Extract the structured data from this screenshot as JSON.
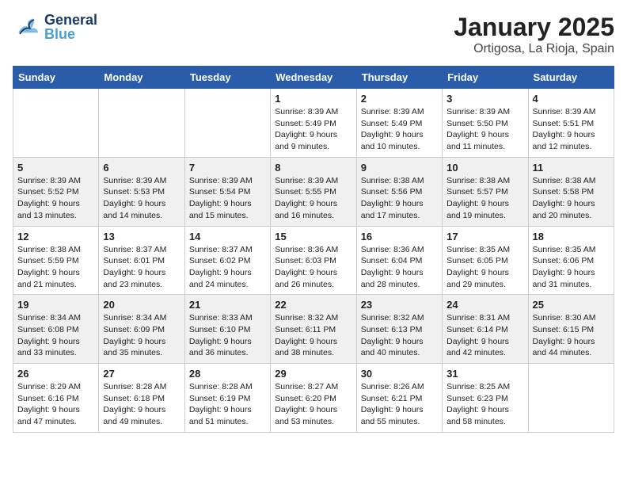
{
  "header": {
    "logo": {
      "line1": "General",
      "line2": "Blue"
    },
    "month": "January 2025",
    "location": "Ortigosa, La Rioja, Spain"
  },
  "weekdays": [
    "Sunday",
    "Monday",
    "Tuesday",
    "Wednesday",
    "Thursday",
    "Friday",
    "Saturday"
  ],
  "weeks": [
    [
      {
        "day": "",
        "info": ""
      },
      {
        "day": "",
        "info": ""
      },
      {
        "day": "",
        "info": ""
      },
      {
        "day": "1",
        "info": "Sunrise: 8:39 AM\nSunset: 5:49 PM\nDaylight: 9 hours\nand 9 minutes."
      },
      {
        "day": "2",
        "info": "Sunrise: 8:39 AM\nSunset: 5:49 PM\nDaylight: 9 hours\nand 10 minutes."
      },
      {
        "day": "3",
        "info": "Sunrise: 8:39 AM\nSunset: 5:50 PM\nDaylight: 9 hours\nand 11 minutes."
      },
      {
        "day": "4",
        "info": "Sunrise: 8:39 AM\nSunset: 5:51 PM\nDaylight: 9 hours\nand 12 minutes."
      }
    ],
    [
      {
        "day": "5",
        "info": "Sunrise: 8:39 AM\nSunset: 5:52 PM\nDaylight: 9 hours\nand 13 minutes."
      },
      {
        "day": "6",
        "info": "Sunrise: 8:39 AM\nSunset: 5:53 PM\nDaylight: 9 hours\nand 14 minutes."
      },
      {
        "day": "7",
        "info": "Sunrise: 8:39 AM\nSunset: 5:54 PM\nDaylight: 9 hours\nand 15 minutes."
      },
      {
        "day": "8",
        "info": "Sunrise: 8:39 AM\nSunset: 5:55 PM\nDaylight: 9 hours\nand 16 minutes."
      },
      {
        "day": "9",
        "info": "Sunrise: 8:38 AM\nSunset: 5:56 PM\nDaylight: 9 hours\nand 17 minutes."
      },
      {
        "day": "10",
        "info": "Sunrise: 8:38 AM\nSunset: 5:57 PM\nDaylight: 9 hours\nand 19 minutes."
      },
      {
        "day": "11",
        "info": "Sunrise: 8:38 AM\nSunset: 5:58 PM\nDaylight: 9 hours\nand 20 minutes."
      }
    ],
    [
      {
        "day": "12",
        "info": "Sunrise: 8:38 AM\nSunset: 5:59 PM\nDaylight: 9 hours\nand 21 minutes."
      },
      {
        "day": "13",
        "info": "Sunrise: 8:37 AM\nSunset: 6:01 PM\nDaylight: 9 hours\nand 23 minutes."
      },
      {
        "day": "14",
        "info": "Sunrise: 8:37 AM\nSunset: 6:02 PM\nDaylight: 9 hours\nand 24 minutes."
      },
      {
        "day": "15",
        "info": "Sunrise: 8:36 AM\nSunset: 6:03 PM\nDaylight: 9 hours\nand 26 minutes."
      },
      {
        "day": "16",
        "info": "Sunrise: 8:36 AM\nSunset: 6:04 PM\nDaylight: 9 hours\nand 28 minutes."
      },
      {
        "day": "17",
        "info": "Sunrise: 8:35 AM\nSunset: 6:05 PM\nDaylight: 9 hours\nand 29 minutes."
      },
      {
        "day": "18",
        "info": "Sunrise: 8:35 AM\nSunset: 6:06 PM\nDaylight: 9 hours\nand 31 minutes."
      }
    ],
    [
      {
        "day": "19",
        "info": "Sunrise: 8:34 AM\nSunset: 6:08 PM\nDaylight: 9 hours\nand 33 minutes."
      },
      {
        "day": "20",
        "info": "Sunrise: 8:34 AM\nSunset: 6:09 PM\nDaylight: 9 hours\nand 35 minutes."
      },
      {
        "day": "21",
        "info": "Sunrise: 8:33 AM\nSunset: 6:10 PM\nDaylight: 9 hours\nand 36 minutes."
      },
      {
        "day": "22",
        "info": "Sunrise: 8:32 AM\nSunset: 6:11 PM\nDaylight: 9 hours\nand 38 minutes."
      },
      {
        "day": "23",
        "info": "Sunrise: 8:32 AM\nSunset: 6:13 PM\nDaylight: 9 hours\nand 40 minutes."
      },
      {
        "day": "24",
        "info": "Sunrise: 8:31 AM\nSunset: 6:14 PM\nDaylight: 9 hours\nand 42 minutes."
      },
      {
        "day": "25",
        "info": "Sunrise: 8:30 AM\nSunset: 6:15 PM\nDaylight: 9 hours\nand 44 minutes."
      }
    ],
    [
      {
        "day": "26",
        "info": "Sunrise: 8:29 AM\nSunset: 6:16 PM\nDaylight: 9 hours\nand 47 minutes."
      },
      {
        "day": "27",
        "info": "Sunrise: 8:28 AM\nSunset: 6:18 PM\nDaylight: 9 hours\nand 49 minutes."
      },
      {
        "day": "28",
        "info": "Sunrise: 8:28 AM\nSunset: 6:19 PM\nDaylight: 9 hours\nand 51 minutes."
      },
      {
        "day": "29",
        "info": "Sunrise: 8:27 AM\nSunset: 6:20 PM\nDaylight: 9 hours\nand 53 minutes."
      },
      {
        "day": "30",
        "info": "Sunrise: 8:26 AM\nSunset: 6:21 PM\nDaylight: 9 hours\nand 55 minutes."
      },
      {
        "day": "31",
        "info": "Sunrise: 8:25 AM\nSunset: 6:23 PM\nDaylight: 9 hours\nand 58 minutes."
      },
      {
        "day": "",
        "info": ""
      }
    ]
  ]
}
